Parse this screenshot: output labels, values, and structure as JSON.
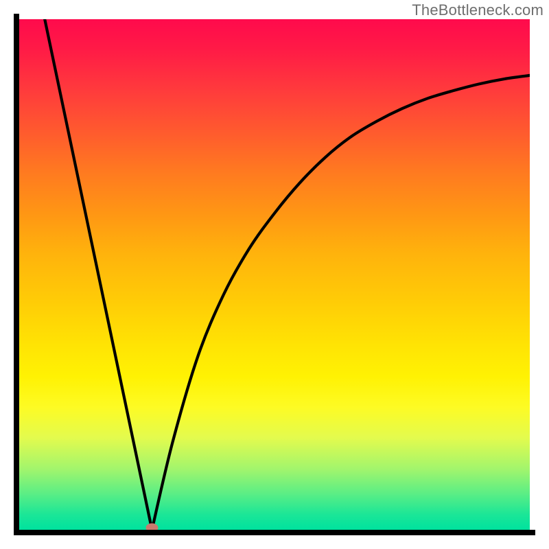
{
  "watermark": "TheBottleneck.com",
  "colors": {
    "axis": "#000000",
    "curve": "#000000",
    "marker": "#c97a6e",
    "gradient_stops": [
      "#ff0a4c",
      "#ff1b46",
      "#ff3b3c",
      "#ff5a2e",
      "#ff7a20",
      "#ff9614",
      "#ffb30c",
      "#ffce06",
      "#ffe404",
      "#fff203",
      "#fdfb24",
      "#e3fb4e",
      "#a3f56c",
      "#5aee85",
      "#1be697",
      "#00e29e"
    ]
  },
  "chart_data": {
    "type": "line",
    "title": "",
    "xlabel": "",
    "ylabel": "",
    "xlim": [
      0,
      100
    ],
    "ylim": [
      0,
      100
    ],
    "x_min": 26,
    "left_branch": {
      "x": [
        5,
        26
      ],
      "y": [
        100,
        0
      ]
    },
    "right_branch": {
      "x": [
        26,
        30,
        35,
        40,
        45,
        50,
        55,
        60,
        65,
        70,
        75,
        80,
        85,
        90,
        95,
        100
      ],
      "y": [
        0,
        17,
        34,
        46,
        55,
        62,
        68,
        73,
        77,
        80,
        82.5,
        84.5,
        86,
        87.3,
        88.3,
        89
      ]
    },
    "marker": {
      "x": 26,
      "y": 0
    },
    "series": [
      {
        "name": "curve",
        "values": "see left_branch + right_branch"
      }
    ],
    "categories": []
  }
}
